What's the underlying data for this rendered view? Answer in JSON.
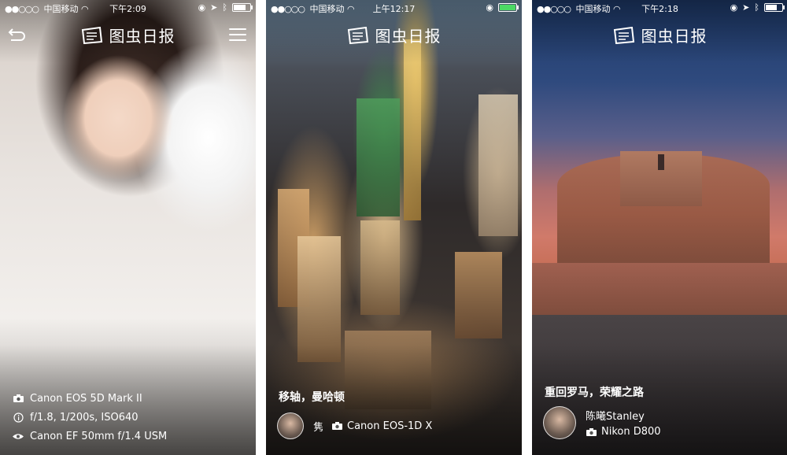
{
  "screens": [
    {
      "status": {
        "carrier": "中国移动",
        "time": "下午2:09"
      },
      "header": {
        "app_name": "图虫日报"
      },
      "exif": {
        "camera": "Canon EOS 5D Mark II",
        "settings": "f/1.8, 1/200s, ISO640",
        "lens": "Canon EF 50mm f/1.4 USM"
      },
      "icons": [
        "back-icon",
        "menu-icon",
        "camera-icon",
        "info-icon",
        "eye-icon"
      ]
    },
    {
      "status": {
        "carrier": "中国移动",
        "time": "上午12:17"
      },
      "header": {
        "app_name": "图虫日报"
      },
      "caption": "移轴，曼哈顿",
      "author": {
        "name": "隽",
        "camera": "Canon EOS-1D X"
      },
      "icons": [
        "camera-icon"
      ]
    },
    {
      "status": {
        "carrier": "中国移动",
        "time": "下午2:18"
      },
      "header": {
        "app_name": "图虫日报"
      },
      "caption": "重回罗马，荣耀之路",
      "author": {
        "name": "陈曦Stanley",
        "camera": "Nikon D800"
      },
      "icons": [
        "camera-icon"
      ]
    }
  ],
  "colors": {
    "battery_charging": "#4cd964",
    "text": "#ffffff"
  }
}
